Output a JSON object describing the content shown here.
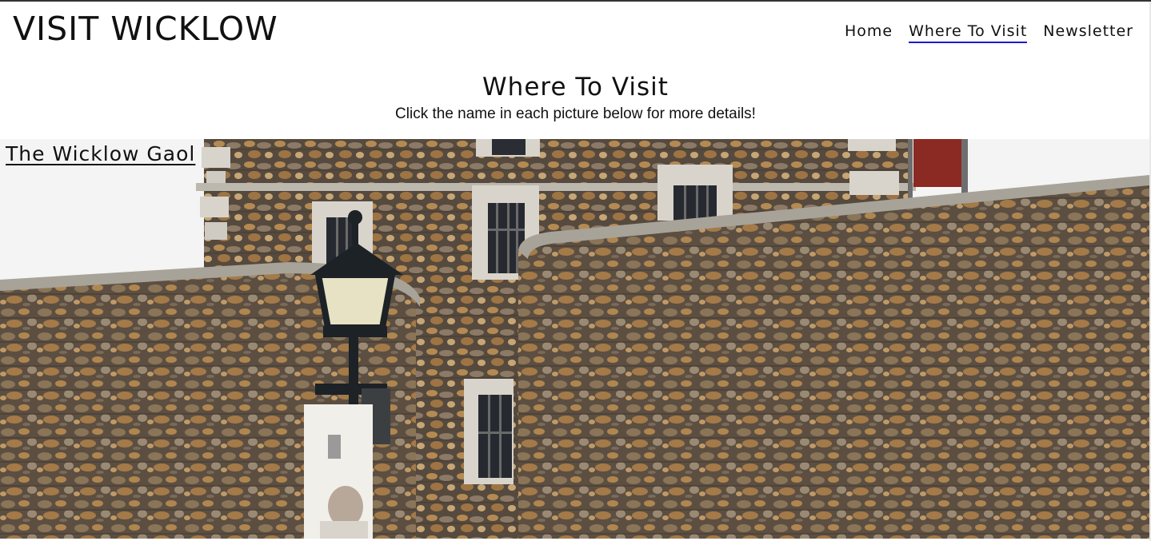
{
  "site": {
    "logo": "VISIT WICKLOW"
  },
  "nav": {
    "items": [
      {
        "label": "Home",
        "active": false
      },
      {
        "label": "Where To Visit",
        "active": true
      },
      {
        "label": "Newsletter",
        "active": false
      }
    ]
  },
  "main": {
    "title": "Where To Visit",
    "subtitle": "Click the name in each picture below for more details!",
    "places": [
      {
        "name": "The Wicklow Gaol"
      }
    ]
  },
  "colors": {
    "active_underline": "#1a1acc",
    "text": "#111111",
    "stone_mortar": "#5a4d40"
  }
}
